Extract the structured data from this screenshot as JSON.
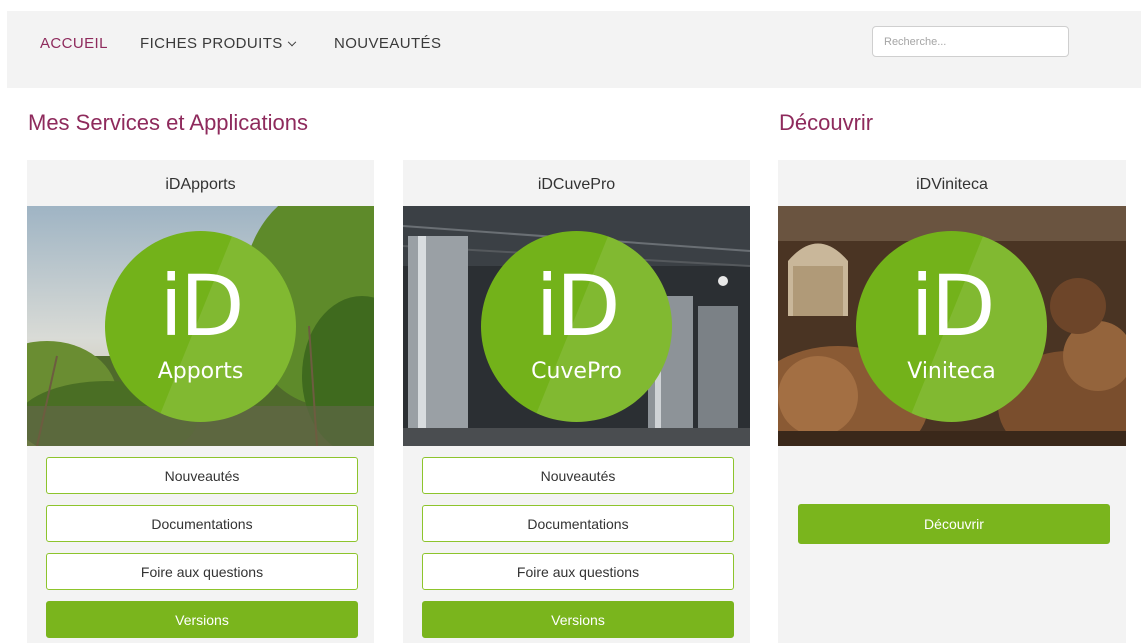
{
  "nav": {
    "items": [
      {
        "label": "ACCUEIL",
        "active": true
      },
      {
        "label": "FICHES PRODUITS",
        "has_dropdown": true
      },
      {
        "label": "NOUVEAUTÉS"
      }
    ],
    "search": {
      "placeholder": "Recherche...",
      "value": ""
    }
  },
  "sections": {
    "services_title": "Mes Services et Applications",
    "discover_title": "Découvrir"
  },
  "cards": [
    {
      "title": "iDApports",
      "logo": {
        "mark": "iD",
        "name": "Apports"
      },
      "buttons": [
        "Nouveautés",
        "Documentations",
        "Foire aux questions"
      ],
      "primary_button": "Versions"
    },
    {
      "title": "iDCuvePro",
      "logo": {
        "mark": "iD",
        "name": "CuvePro"
      },
      "buttons": [
        "Nouveautés",
        "Documentations",
        "Foire aux questions"
      ],
      "primary_button": "Versions"
    },
    {
      "title": "iDViniteca",
      "logo": {
        "mark": "iD",
        "name": "Viniteca"
      },
      "primary_button": "Découvrir"
    }
  ],
  "colors": {
    "brand_purple": "#8e2a5c",
    "brand_green": "#7ab51d",
    "logo_green": "#73b21a",
    "nav_background": "#f3f3f3"
  }
}
